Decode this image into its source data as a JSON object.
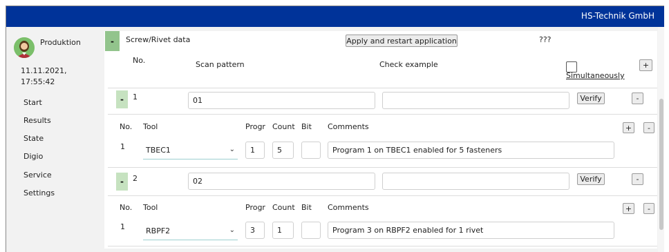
{
  "header": {
    "brand": "HS-Technik GmbH"
  },
  "user": {
    "name": "Produktion",
    "datetime": "11.11.2021,\n17:55:42"
  },
  "nav": [
    "Start",
    "Results",
    "State",
    "Digio",
    "Service",
    "Settings"
  ],
  "panel": {
    "toggle": "-",
    "title": "Screw/Rivet data",
    "apply_button": "Apply and restart application",
    "unknown_label": "???",
    "add_button": "+"
  },
  "columns": {
    "no": "No.",
    "scan_pattern": "Scan pattern",
    "check_example": "Check example",
    "simultaneously": "Simultaneously"
  },
  "sub_columns": {
    "no": "No.",
    "tool": "Tool",
    "progr": "Progr",
    "count": "Count",
    "bit": "Bit",
    "comments": "Comments"
  },
  "entries": [
    {
      "toggle": "-",
      "no": "1",
      "scan_pattern": "01",
      "check_example": "",
      "verify": "Verify",
      "remove": "-",
      "add_tool": "+",
      "remove_tool": "-",
      "tools": [
        {
          "no": "1",
          "tool": "TBEC1",
          "progr": "1",
          "count": "5",
          "bit": "",
          "comments": "Program 1 on TBEC1 enabled for 5 fasteners"
        }
      ]
    },
    {
      "toggle": "-",
      "no": "2",
      "scan_pattern": "02",
      "check_example": "",
      "verify": "Verify",
      "remove": "-",
      "add_tool": "+",
      "remove_tool": "-",
      "tools": [
        {
          "no": "1",
          "tool": "RBPF2",
          "progr": "3",
          "count": "1",
          "bit": "",
          "comments": "Program 3 on RBPF2 enabled for 1 rivet"
        }
      ]
    }
  ],
  "icons": {
    "user_avatar": "user-avatar-icon",
    "dropdown": "chevron-down-icon"
  },
  "colors": {
    "topbar": "#003399",
    "toggle": "#92c48c",
    "toggle_light": "#c6e2c0"
  }
}
